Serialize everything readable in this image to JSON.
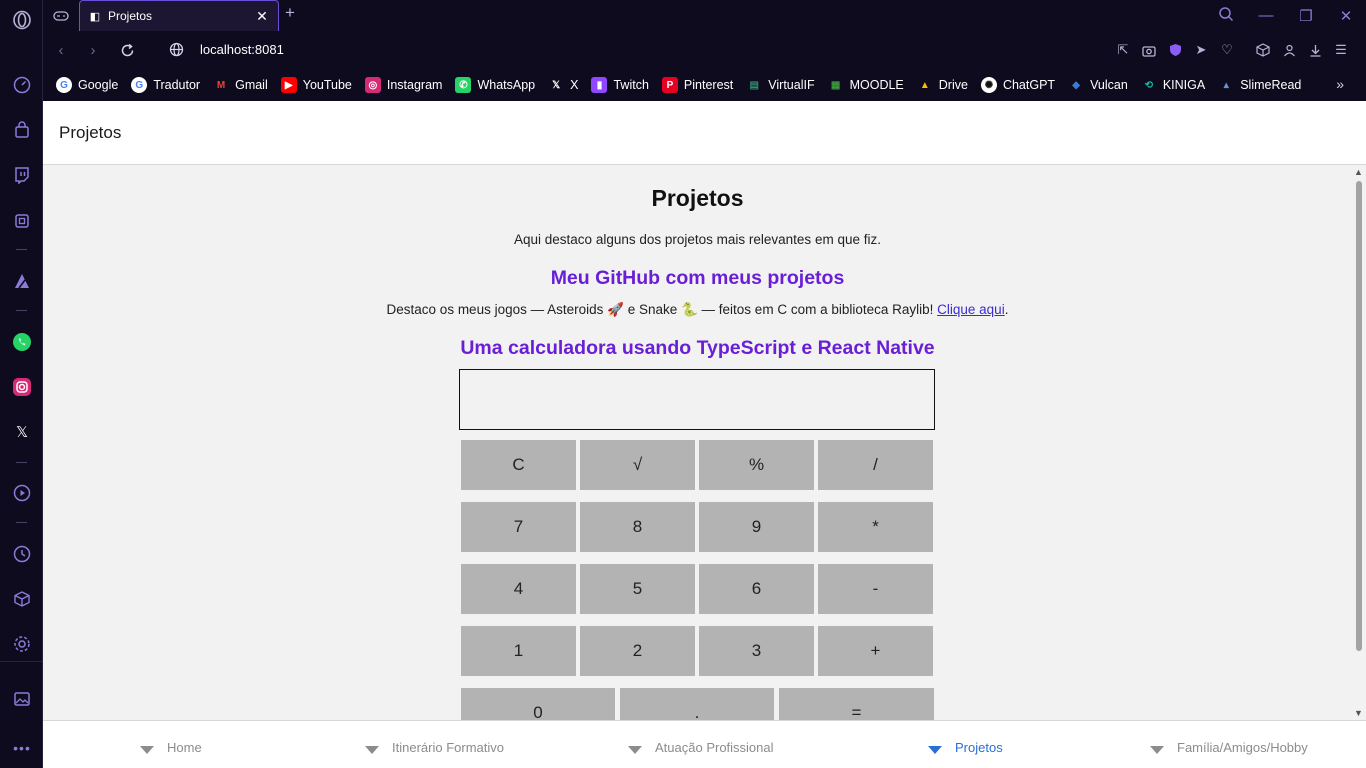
{
  "browser": {
    "tab_title": "Projetos",
    "url": "localhost:8081",
    "accent_color": "#8b7bd8"
  },
  "sidebar": {
    "items": [
      "opera-logo-icon",
      "speed-dial-icon",
      "shopping-bag-icon",
      "twitch-icon",
      "ai-chip-icon",
      "aria-icon",
      "whatsapp-icon",
      "instagram-icon",
      "x-icon",
      "player-icon",
      "history-icon",
      "cube-icon",
      "settings-icon",
      "gallery-icon",
      "more-icon"
    ]
  },
  "bookmarks": [
    {
      "label": "Google",
      "color": "#ffffff"
    },
    {
      "label": "Tradutor",
      "color": "#ffffff"
    },
    {
      "label": "Gmail",
      "color": "#ea4335"
    },
    {
      "label": "YouTube",
      "color": "#ff0000"
    },
    {
      "label": "Instagram",
      "color": "#d62976"
    },
    {
      "label": "WhatsApp",
      "color": "#25d366"
    },
    {
      "label": "X",
      "color": "#000000"
    },
    {
      "label": "Twitch",
      "color": "#9146ff"
    },
    {
      "label": "Pinterest",
      "color": "#e60023"
    },
    {
      "label": "VirtualIF",
      "color": "#2a8f6e"
    },
    {
      "label": "MOODLE",
      "color": "#3a9a3a"
    },
    {
      "label": "Drive",
      "color": "#4285f4"
    },
    {
      "label": "ChatGPT",
      "color": "#ffffff"
    },
    {
      "label": "Vulcan",
      "color": "#3a7bd5"
    },
    {
      "label": "KINIGA",
      "color": "#18b9a0"
    },
    {
      "label": "SlimeRead",
      "color": "#6a8fd6"
    }
  ],
  "page": {
    "header_title": "Projetos",
    "heading": "Projetos",
    "intro": "Aqui destaco alguns dos projetos mais relevantes em que fiz.",
    "github_heading": "Meu GitHub com meus projetos",
    "desc_text": "Destaco os meus jogos — Asteroids 🚀 e Snake 🐍 — feitos em C com a biblioteca Raylib! ",
    "desc_link": "Clique aqui",
    "desc_end": ".",
    "calc_heading": "Uma calculadora usando TypeScript e React Native",
    "calc_display_value": "",
    "calc_buttons": [
      "C",
      "√",
      "%",
      "/",
      "7",
      "8",
      "9",
      "*",
      "4",
      "5",
      "6",
      "-",
      "1",
      "2",
      "3",
      "+",
      "0",
      ".",
      "="
    ]
  },
  "bottom_tabs": [
    {
      "label": "Home",
      "active": false
    },
    {
      "label": "Itinerário Formativo",
      "active": false
    },
    {
      "label": "Atuação Profissional",
      "active": false
    },
    {
      "label": "Projetos",
      "active": true
    },
    {
      "label": "Família/Amigos/Hobby",
      "active": false
    }
  ]
}
